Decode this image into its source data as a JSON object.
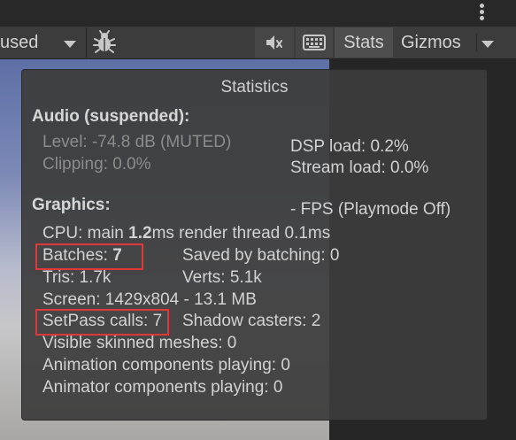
{
  "toolbar": {
    "dropdown_label": "used",
    "stats_label": "Stats",
    "gizmos_label": "Gizmos"
  },
  "stats": {
    "title": "Statistics",
    "audio_header": "Audio (suspended):",
    "level": "Level: -74.8 dB (MUTED)",
    "clipping": "Clipping: 0.0%",
    "dsp_load": "DSP load: 0.2%",
    "stream_load": "Stream load: 0.0%",
    "graphics_header": "Graphics:",
    "fps": "- FPS (Playmode Off)",
    "cpu_prefix": "CPU: main ",
    "cpu_main": "1.2",
    "cpu_suffix": "ms  render thread 0.1ms",
    "batches_label": "Batches: ",
    "batches_value": "7",
    "saved_by_batching": "Saved by batching: 0",
    "tris": "Tris: 1.7k",
    "verts": "Verts: 5.1k",
    "screen": "Screen: 1429x804 - 13.1 MB",
    "setpass_label": "SetPass calls: ",
    "setpass_value": "7",
    "shadow_casters": "Shadow casters: 2",
    "skinned_meshes": "Visible skinned meshes: 0",
    "animation_components": "Animation components playing: 0",
    "animator_components": "Animator components playing: 0"
  }
}
